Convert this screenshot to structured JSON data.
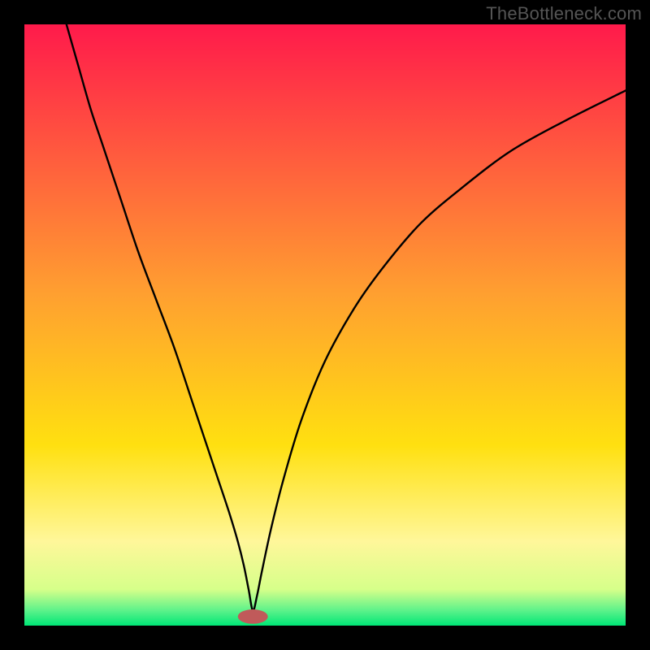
{
  "watermark": "TheBottleneck.com",
  "chart_data": {
    "type": "line",
    "title": "",
    "xlabel": "",
    "ylabel": "",
    "xlim": [
      0,
      100
    ],
    "ylim": [
      0,
      100
    ],
    "legend": false,
    "grid": false,
    "background_gradient": {
      "stops": [
        {
          "offset": 0.0,
          "color": "#ff1a4b"
        },
        {
          "offset": 0.45,
          "color": "#ffa030"
        },
        {
          "offset": 0.7,
          "color": "#ffe010"
        },
        {
          "offset": 0.86,
          "color": "#fff79a"
        },
        {
          "offset": 0.94,
          "color": "#d6ff8a"
        },
        {
          "offset": 0.975,
          "color": "#5cf28a"
        },
        {
          "offset": 1.0,
          "color": "#00e676"
        }
      ]
    },
    "marker": {
      "x": 38,
      "y": 1.5,
      "color": "#c05a5a",
      "rx": 2.5,
      "ry": 1.2
    },
    "series": [
      {
        "name": "curve",
        "x": [
          7,
          9,
          11,
          13,
          16,
          19,
          22,
          25,
          28,
          30,
          32,
          34,
          35.5,
          36.5,
          37.3,
          38,
          38.7,
          39.5,
          41,
          43,
          46,
          50,
          55,
          60,
          66,
          73,
          81,
          90,
          100
        ],
        "y": [
          100,
          93,
          86,
          80,
          71,
          62,
          54,
          46,
          37,
          31,
          25,
          19,
          14,
          10,
          6,
          2.5,
          5,
          9,
          16,
          24,
          34,
          44,
          53,
          60,
          67,
          73,
          79,
          84,
          89
        ]
      }
    ]
  }
}
